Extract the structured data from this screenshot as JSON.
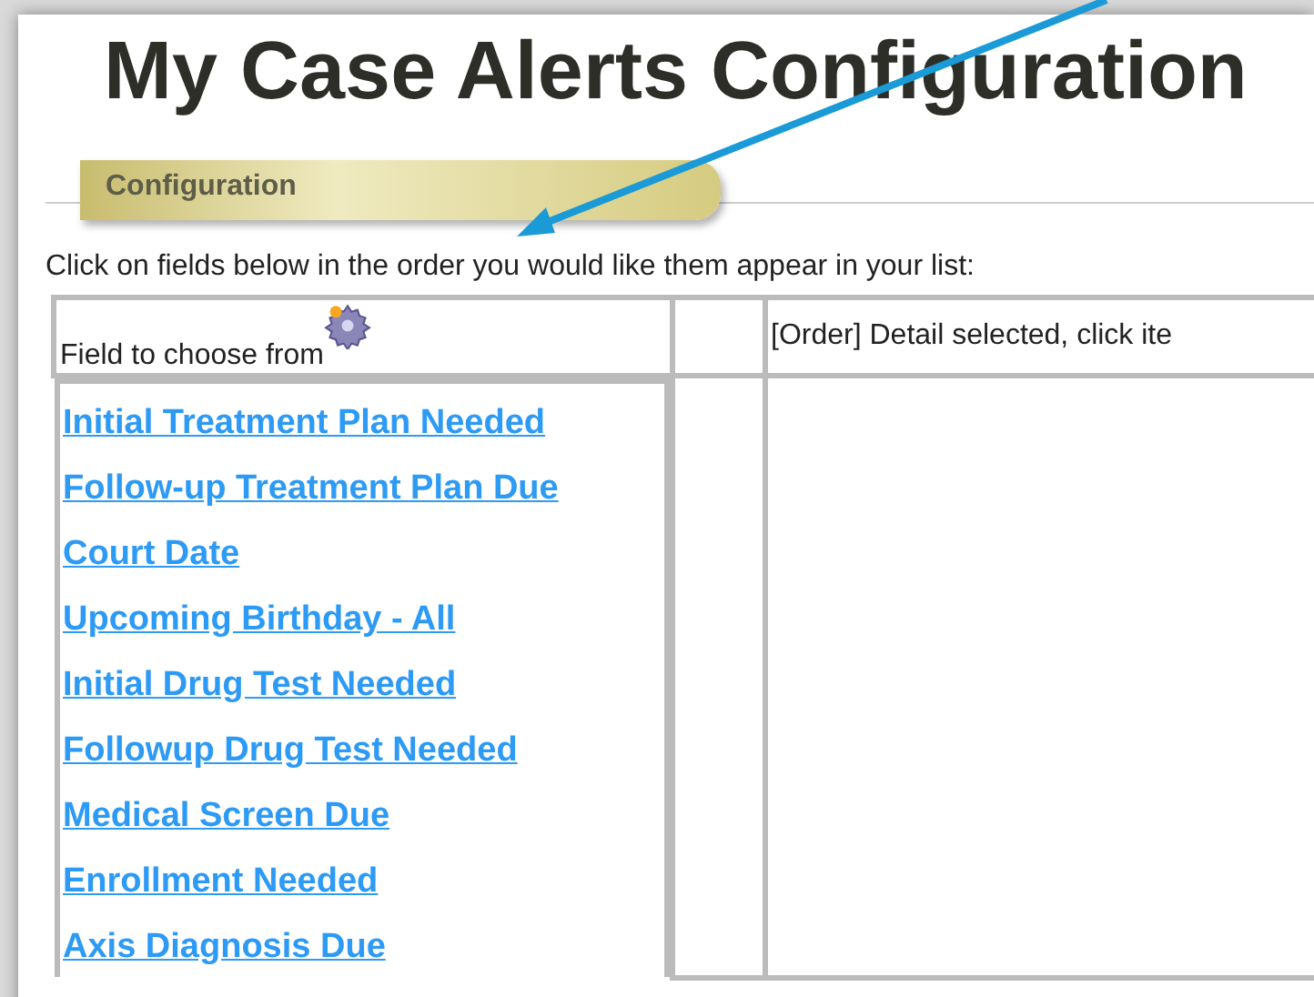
{
  "title": "My Case Alerts Configuration",
  "tabs": [
    {
      "label": "Configuration",
      "selected": true
    }
  ],
  "instruction": "Click on fields below in the order you would like them appear in your list:",
  "table": {
    "columns": [
      "Field to choose from",
      "[Order] Detail selected, click ite"
    ],
    "fields": [
      "Initial Treatment Plan Needed",
      "Follow-up Treatment Plan Due",
      "Court Date",
      "Upcoming Birthday - All",
      "Initial Drug Test Needed",
      "Followup Drug Test Needed",
      "Medical Screen Due",
      "Enrollment Needed",
      "Axis Diagnosis Due"
    ]
  }
}
